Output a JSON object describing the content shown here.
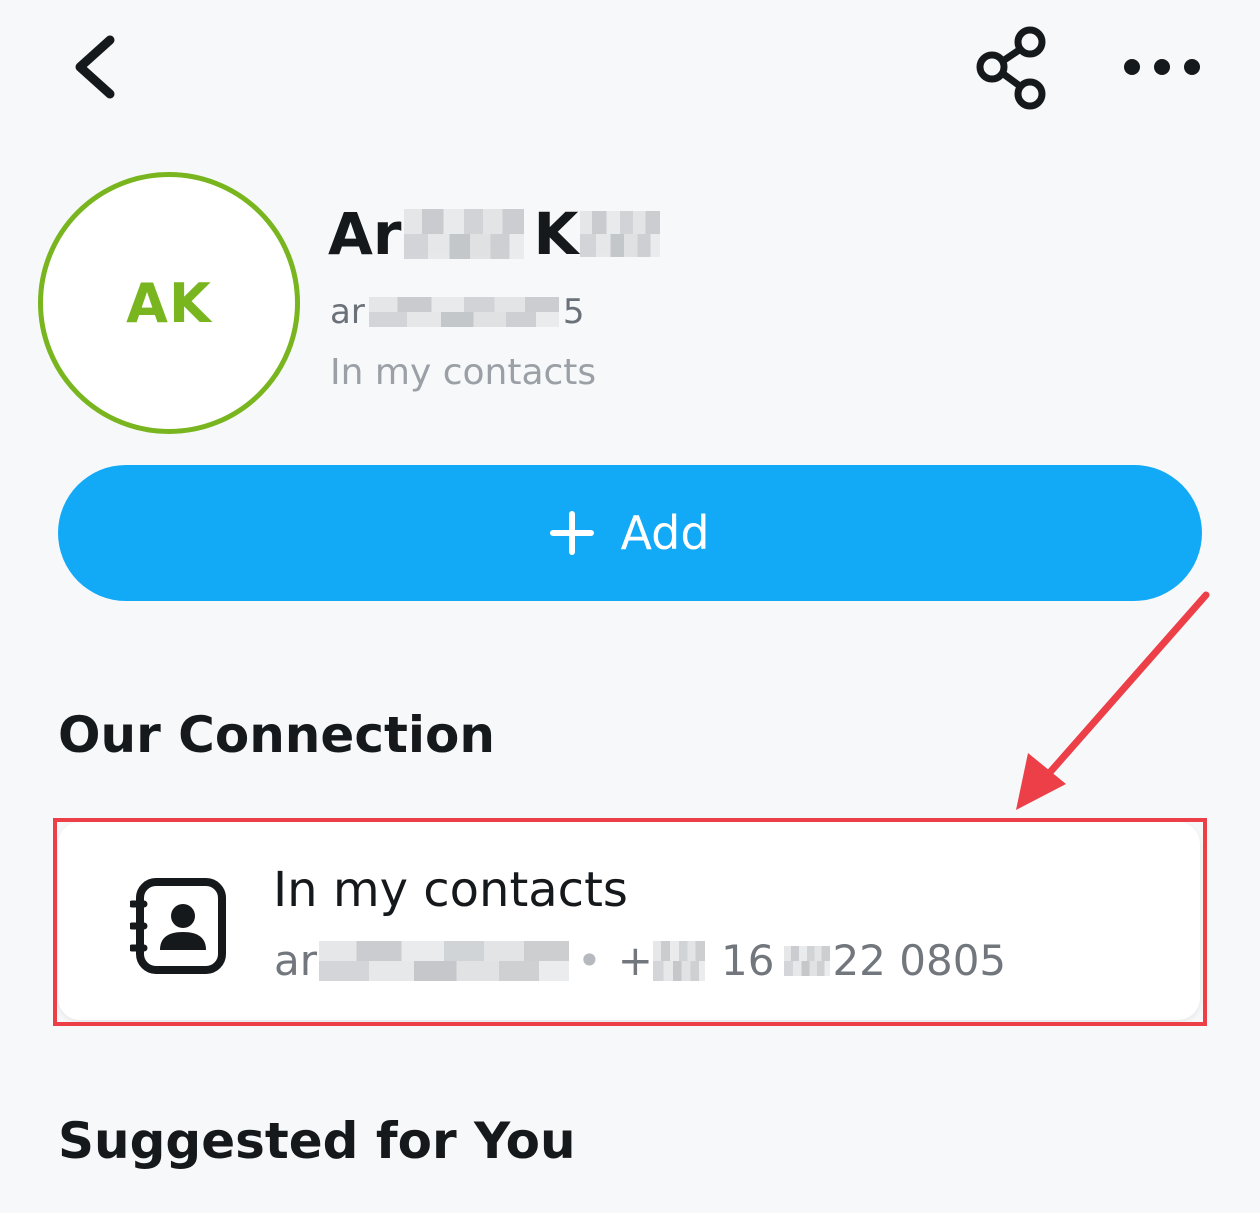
{
  "header": {
    "back_icon": "chevron-left-icon",
    "share_icon": "share-icon",
    "more_icon": "more-horizontal-icon"
  },
  "profile": {
    "initials": "AK",
    "avatar_ring_color": "#78b51e",
    "name_first_visible": "Ar",
    "name_last_visible": "K",
    "username_start": "ar",
    "username_end": "5",
    "status": "In my contacts"
  },
  "add_button": {
    "label": "Add",
    "icon": "plus-icon",
    "color": "#12aaf7"
  },
  "connection": {
    "title": "Our Connection",
    "card": {
      "icon": "contact-book-icon",
      "title": "In my contacts",
      "username_start": "ar",
      "separator": "•",
      "phone_prefix": "+",
      "phone_part1": "16",
      "phone_part2": "22 0805"
    }
  },
  "suggested": {
    "title": "Suggested for You"
  },
  "annotation": {
    "highlight_color": "#ec3f48"
  }
}
